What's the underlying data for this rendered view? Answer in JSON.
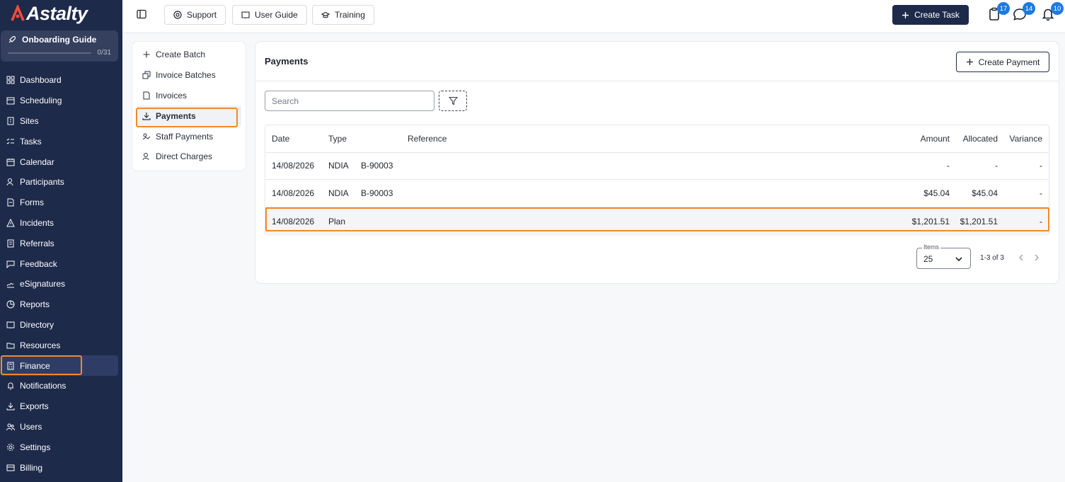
{
  "app": {
    "logo_text": "Astalty"
  },
  "onboarding": {
    "title": "Onboarding Guide",
    "progress": "0/31",
    "progress_fraction": 0
  },
  "sidebar": {
    "items": [
      {
        "label": "Dashboard",
        "icon": "dashboard-icon"
      },
      {
        "label": "Scheduling",
        "icon": "calendar-clock-icon"
      },
      {
        "label": "Sites",
        "icon": "building-icon"
      },
      {
        "label": "Tasks",
        "icon": "checklist-icon"
      },
      {
        "label": "Calendar",
        "icon": "calendar-icon"
      },
      {
        "label": "Participants",
        "icon": "users-icon"
      },
      {
        "label": "Forms",
        "icon": "document-icon"
      },
      {
        "label": "Incidents",
        "icon": "warning-icon"
      },
      {
        "label": "Referrals",
        "icon": "referral-icon"
      },
      {
        "label": "Feedback",
        "icon": "message-icon"
      },
      {
        "label": "eSignatures",
        "icon": "signature-icon"
      },
      {
        "label": "Reports",
        "icon": "pie-chart-icon"
      },
      {
        "label": "Directory",
        "icon": "book-icon"
      },
      {
        "label": "Resources",
        "icon": "folder-icon"
      },
      {
        "label": "Finance",
        "icon": "calculator-icon",
        "active": true
      },
      {
        "label": "Notifications",
        "icon": "bell-icon"
      },
      {
        "label": "Exports",
        "icon": "download-icon"
      },
      {
        "label": "Users",
        "icon": "user-group-icon"
      },
      {
        "label": "Settings",
        "icon": "gear-icon"
      },
      {
        "label": "Billing",
        "icon": "credit-card-icon"
      }
    ]
  },
  "topbar": {
    "support_label": "Support",
    "user_guide_label": "User Guide",
    "training_label": "Training",
    "create_task_label": "Create Task",
    "tasks_badge": "17",
    "messages_badge": "14",
    "notifications_badge": "10"
  },
  "subnav": {
    "items": [
      {
        "label": "Create Batch",
        "icon": "plus-icon"
      },
      {
        "label": "Invoice Batches",
        "icon": "batches-icon"
      },
      {
        "label": "Invoices",
        "icon": "invoice-icon"
      },
      {
        "label": "Payments",
        "icon": "download-icon",
        "active": true
      },
      {
        "label": "Staff Payments",
        "icon": "staff-payments-icon"
      },
      {
        "label": "Direct Charges",
        "icon": "direct-charges-icon"
      }
    ]
  },
  "main": {
    "title": "Payments",
    "create_payment_label": "Create Payment",
    "search_placeholder": "Search",
    "table": {
      "headers": {
        "date": "Date",
        "type": "Type",
        "reference": "Reference",
        "amount": "Amount",
        "allocated": "Allocated",
        "variance": "Variance"
      },
      "rows": [
        {
          "date": "14/08/2026",
          "type": "NDIA",
          "batch": "B-90003",
          "reference": "",
          "amount": "-",
          "allocated": "-",
          "variance": "-"
        },
        {
          "date": "14/08/2026",
          "type": "NDIA",
          "batch": "B-90003",
          "reference": "",
          "amount": "$45.04",
          "allocated": "$45.04",
          "variance": "-"
        },
        {
          "date": "14/08/2026",
          "type": "Plan",
          "batch": "",
          "reference": "",
          "amount": "$1,201.51",
          "allocated": "$1,201.51",
          "variance": "-"
        }
      ]
    },
    "pagination": {
      "items_label": "Items",
      "items_value": "25",
      "range": "1-3 of 3"
    }
  },
  "colors": {
    "sidebar_bg": "#1e2a4a",
    "highlight": "#f08a2c",
    "badge": "#1d7ae0"
  }
}
